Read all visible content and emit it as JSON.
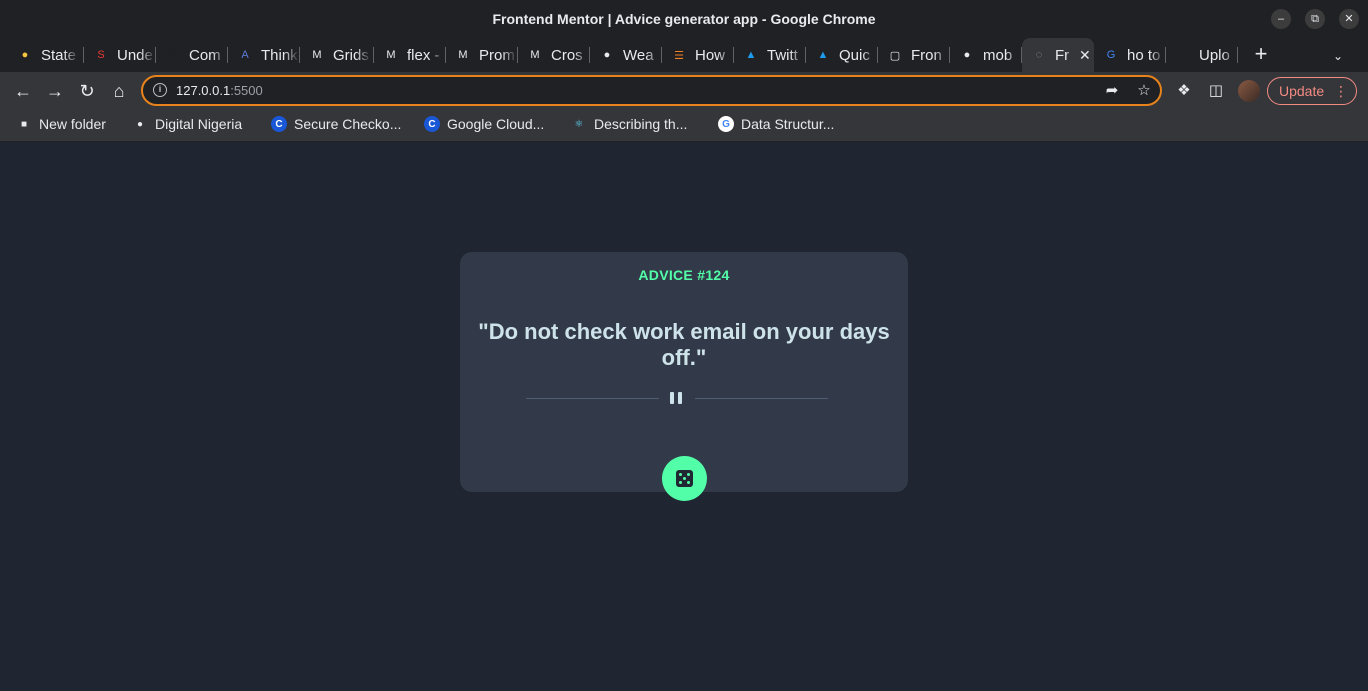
{
  "window": {
    "title": "Frontend Mentor | Advice generator app - Google Chrome",
    "controls": [
      "minimize",
      "restore",
      "close"
    ]
  },
  "tabs": [
    {
      "label": "State",
      "icon": "owl-icon",
      "color": "#f4c542"
    },
    {
      "label": "Unde",
      "icon": "brand-s-icon",
      "color": "#e53935"
    },
    {
      "label": "Com",
      "icon": "phone-icon",
      "color": "#202124"
    },
    {
      "label": "Think",
      "icon": "angular-icon",
      "color": "#5a7bd6"
    },
    {
      "label": "Grids",
      "icon": "m-logo-icon",
      "color": "#e8eaed"
    },
    {
      "label": "flex -",
      "icon": "m-logo-icon",
      "color": "#e8eaed"
    },
    {
      "label": "Prom",
      "icon": "m-logo-icon",
      "color": "#e8eaed"
    },
    {
      "label": "Cros",
      "icon": "m-logo-icon",
      "color": "#e8eaed"
    },
    {
      "label": "Wea",
      "icon": "globe-icon",
      "color": "#e8eaed"
    },
    {
      "label": "How",
      "icon": "stackoverflow-icon",
      "color": "#f48024"
    },
    {
      "label": "Twitt",
      "icon": "twitter-icon",
      "color": "#1d9bf0"
    },
    {
      "label": "Quic",
      "icon": "twitter-icon",
      "color": "#1d9bf0"
    },
    {
      "label": "Fron",
      "icon": "page-icon",
      "color": "#e8eaed"
    },
    {
      "label": "mob",
      "icon": "globe-icon",
      "color": "#e8eaed"
    },
    {
      "label": "Fr",
      "icon": "loading-icon",
      "color": "#9aa0a6",
      "active": true
    },
    {
      "label": "ho to",
      "icon": "google-icon",
      "color": "#4285f4"
    },
    {
      "label": "Uplo",
      "icon": "github-icon",
      "color": "#202124"
    }
  ],
  "toolbar": {
    "url_host": "127.0.0.1",
    "url_port": ":5500",
    "update_label": "Update"
  },
  "bookmarks": [
    {
      "label": "New folder",
      "icon": "folder-icon"
    },
    {
      "label": "Digital Nigeria",
      "icon": "globe-icon"
    },
    {
      "label": "Secure Checko...",
      "icon": "c-logo-icon"
    },
    {
      "label": "Google Cloud...",
      "icon": "c-logo-icon"
    },
    {
      "label": "Describing th...",
      "icon": "react-icon"
    },
    {
      "label": "Data Structur...",
      "icon": "google-icon"
    }
  ],
  "advice": {
    "id_label": "ADVICE #124",
    "quote": "\"Do not check work email on your days off.\""
  },
  "colors": {
    "page_bg": "#1f2531",
    "card_bg": "#323a49",
    "accent": "#52ffa8",
    "quote_text": "#cee3e9"
  }
}
